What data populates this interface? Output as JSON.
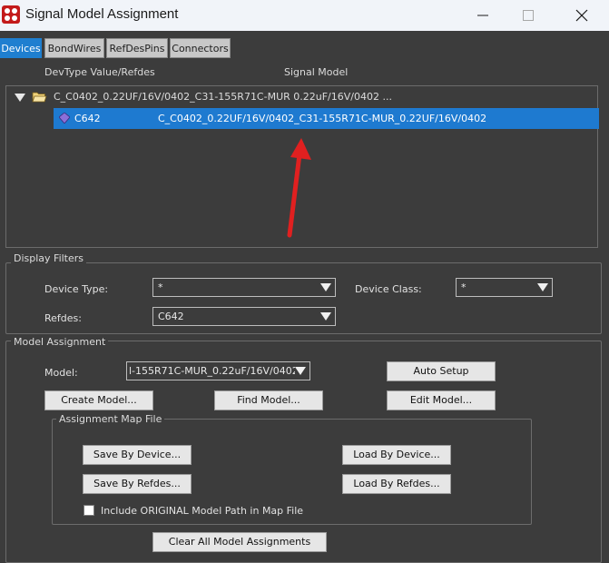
{
  "window": {
    "title": "Signal Model Assignment",
    "icon": "app-logo-icon"
  },
  "tabs": [
    {
      "label": "Devices",
      "active": true
    },
    {
      "label": "BondWires",
      "active": false
    },
    {
      "label": "RefDesPins",
      "active": false
    },
    {
      "label": "Connectors",
      "active": false
    }
  ],
  "columns": {
    "devtype": "DevType Value/Refdes",
    "signal_model": "Signal Model"
  },
  "tree": {
    "parent": {
      "label": "C_C0402_0.22UF/16V/0402_C31-155R71C-MUR 0.22uF/16V/0402 ...",
      "expanded": true
    },
    "child": {
      "refdes": "C642",
      "model": "C_C0402_0.22UF/16V/0402_C31-155R71C-MUR_0.22UF/16V/0402",
      "selected": true
    }
  },
  "display_filters": {
    "title": "Display Filters",
    "device_type_label": "Device Type:",
    "device_type_value": "*",
    "device_class_label": "Device Class:",
    "device_class_value": "*",
    "refdes_label": "Refdes:",
    "refdes_value": "C642"
  },
  "model_assignment": {
    "title": "Model Assignment",
    "model_label": "Model:",
    "model_value": "l-155R71C-MUR_0.22uF/16V/0402",
    "auto_setup": "Auto Setup",
    "create_model": "Create Model...",
    "find_model": "Find Model...",
    "edit_model": "Edit Model...",
    "map_file": {
      "title": "Assignment Map File",
      "save_by_device": "Save By Device...",
      "load_by_device": "Load By Device...",
      "save_by_refdes": "Save By Refdes...",
      "load_by_refdes": "Load By Refdes...",
      "include_original_label": "Include ORIGINAL Model Path in Map File",
      "include_original_checked": false
    },
    "clear_all": "Clear All Model Assignments"
  },
  "colors": {
    "background": "#3c3c3c",
    "selection": "#1e7ad0",
    "active_tab": "#1f7fd0",
    "annotation_arrow": "#e02020"
  }
}
